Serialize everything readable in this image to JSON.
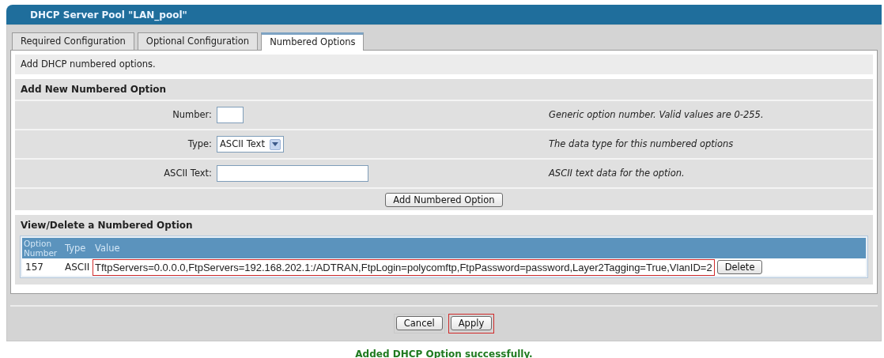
{
  "window": {
    "title": "DHCP Server Pool \"LAN_pool\""
  },
  "tabs": [
    {
      "label": "Required Configuration",
      "selected": false
    },
    {
      "label": "Optional Configuration",
      "selected": false
    },
    {
      "label": "Numbered Options",
      "selected": true
    }
  ],
  "intro": "Add DHCP numbered options.",
  "add_section": {
    "title": "Add New Numbered Option",
    "fields": [
      {
        "kind": "text",
        "label": "Number:",
        "help": "Generic option number. Valid values are 0-255."
      },
      {
        "kind": "select",
        "label": "Type:",
        "value": "ASCII Text",
        "help": "The data type for this numbered options"
      },
      {
        "kind": "text",
        "label": "ASCII Text:",
        "help": "ASCII text data for the option."
      }
    ],
    "button": "Add Numbered Option"
  },
  "view_section": {
    "title": "View/Delete a Numbered Option",
    "columns": [
      "Option Number",
      "Type",
      "Value"
    ],
    "rows": [
      {
        "number": "157",
        "type": "ASCII",
        "value": "TftpServers=0.0.0.0,FtpServers=192.168.202.1:/ADTRAN,FtpLogin=polycomftp,FtpPassword=password,Layer2Tagging=True,VlanID=2",
        "value_highlighted": true,
        "button": "Delete"
      }
    ]
  },
  "buttons": [
    {
      "label": "Cancel",
      "highlighted": false
    },
    {
      "label": "Apply",
      "highlighted": true
    }
  ],
  "message": "Added DHCP Option successfully."
}
